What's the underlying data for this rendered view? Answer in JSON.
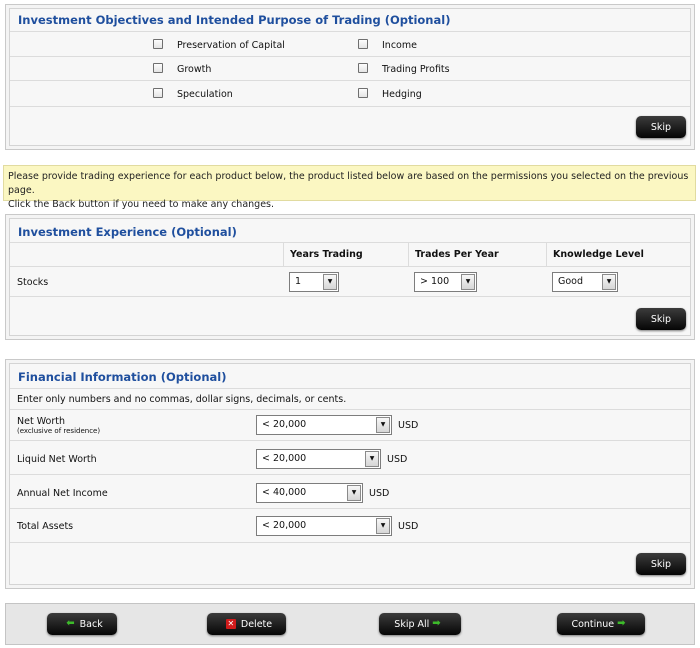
{
  "objectives": {
    "title": "Investment Objectives and Intended Purpose of Trading (Optional)",
    "options": [
      "Preservation of Capital",
      "Income",
      "Growth",
      "Trading Profits",
      "Speculation",
      "Hedging"
    ],
    "skip_label": "Skip"
  },
  "notice": {
    "line1": "Please provide trading experience for each product below, the product listed below are based on the permissions you selected on the previous page.",
    "line2": "Click the Back button if you need to make any changes."
  },
  "experience": {
    "title": "Investment Experience (Optional)",
    "columns": [
      "Years Trading",
      "Trades Per Year",
      "Knowledge Level"
    ],
    "row": {
      "product": "Stocks",
      "years": "1",
      "trades": "> 100",
      "knowledge": "Good"
    },
    "skip_label": "Skip"
  },
  "financial": {
    "title": "Financial Information (Optional)",
    "instructions": "Enter only numbers and no commas, dollar signs, decimals, or cents.",
    "fields": [
      {
        "label": "Net Worth",
        "sublabel": "(exclusive of residence)",
        "value": "< 20,000",
        "unit": "USD"
      },
      {
        "label": "Liquid Net Worth",
        "value": "< 20,000",
        "unit": "USD"
      },
      {
        "label": "Annual Net Income",
        "value": "< 40,000",
        "unit": "USD"
      },
      {
        "label": "Total Assets",
        "value": "< 20,000",
        "unit": "USD"
      }
    ],
    "skip_label": "Skip"
  },
  "footer": {
    "back_label": "Back",
    "delete_label": "Delete",
    "skip_all_label": "Skip All",
    "continue_label": "Continue"
  },
  "colors": {
    "title_blue": "#1f4f9e",
    "notice_bg": "#fbf7c2",
    "arrow_green": "#3dbb2a",
    "delete_red": "#d01b1b"
  },
  "icons": {
    "back": "left-arrow-icon",
    "delete": "x-icon",
    "skip_all": "right-arrow-icon",
    "continue": "right-arrow-icon",
    "select": "chevron-down-icon"
  }
}
